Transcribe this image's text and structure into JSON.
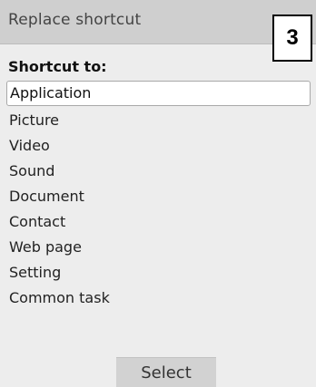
{
  "header": {
    "title": "Replace shortcut",
    "step_number": "3"
  },
  "list": {
    "heading": "Shortcut to:",
    "selected_index": 0,
    "items": [
      "Application",
      "Picture",
      "Video",
      "Sound",
      "Document",
      "Contact",
      "Web page",
      "Setting",
      "Common task"
    ]
  },
  "softkeys": {
    "center_label": "Select"
  },
  "colors": {
    "background": "#ededed",
    "title_bar": "#cfcfcf",
    "selection_fill": "#ffffff",
    "softkey": "#d2d2d2"
  }
}
